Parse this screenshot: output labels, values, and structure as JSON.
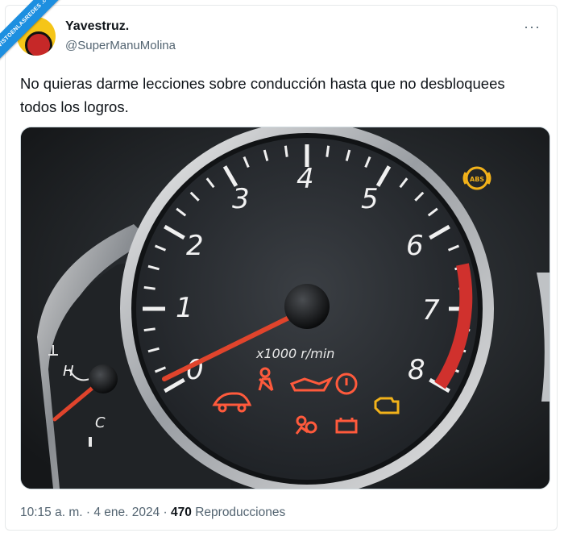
{
  "watermark": "VISTOENLASREDES .com",
  "tweet": {
    "display_name": "Yavestruz.",
    "handle": "@SuperManuMolina",
    "more_label": "···",
    "text": "No quieras darme lecciones sobre conducción hasta que no desbloquees todos los logros.",
    "time": "10:15 a. m.",
    "separator": "·",
    "date": "4 ene. 2024",
    "views_count": "470",
    "views_label": "Reproducciones"
  },
  "gauge": {
    "tick_labels": [
      "1",
      "2",
      "3",
      "4",
      "5",
      "6",
      "7",
      "8"
    ],
    "zero_label": "0",
    "unit_label": "x1000 r/min",
    "temp_high": "H",
    "temp_low": "C"
  },
  "warning_lights": [
    "abs-light",
    "car-alarm-light",
    "seatbelt-light",
    "oil-pressure-light",
    "brake-light",
    "check-engine-light",
    "airbag-light",
    "battery-light"
  ],
  "colors": {
    "warning_red": "#ff5a3c",
    "warning_amber": "#f2b21a",
    "needle": "#e0442c",
    "redline": "#d0312d"
  }
}
